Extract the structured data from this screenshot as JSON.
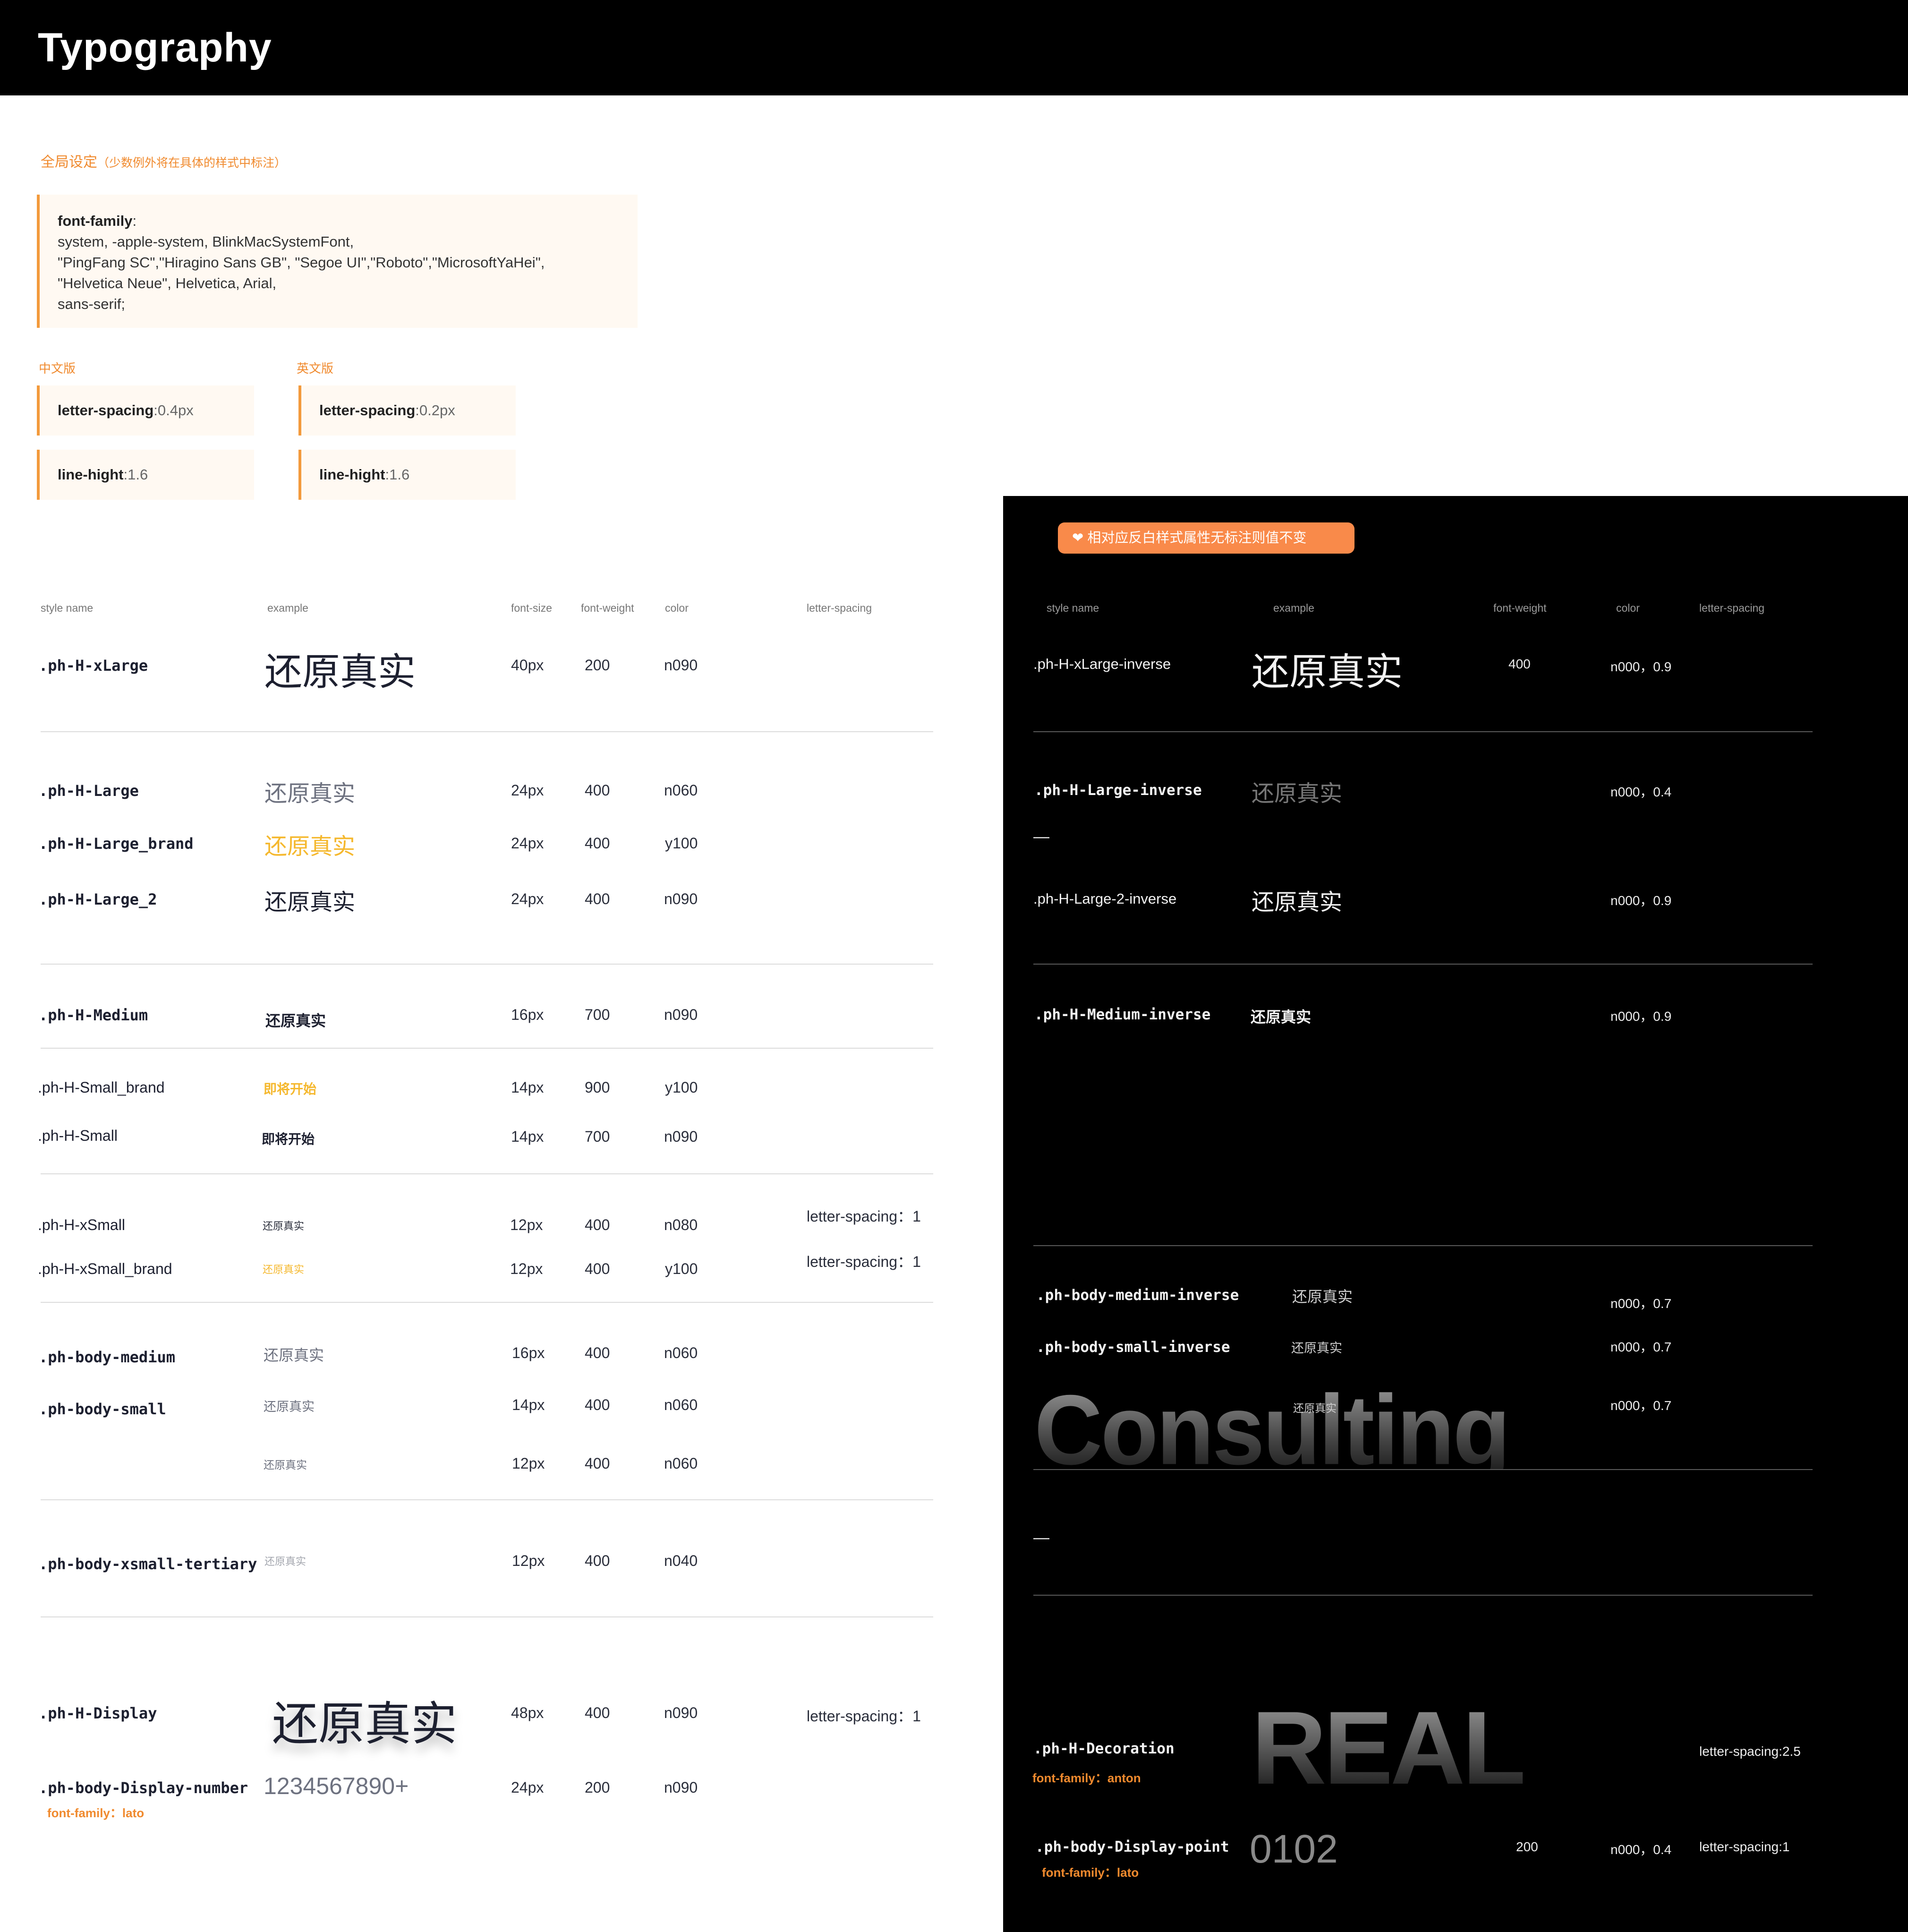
{
  "header": {
    "title": "Typography"
  },
  "global": {
    "heading": "全局设定",
    "heading_note": "（少数例外将在具体的样式中标注）",
    "font_family_label": "font-family",
    "font_family_colon": ":",
    "font_family_lines": [
      "system, -apple-system, BlinkMacSystemFont,",
      "\"PingFang SC\",\"Hiragino Sans GB\", \"Segoe UI\",\"Roboto\",\"MicrosoftYaHei\",",
      "\"Helvetica Neue\", Helvetica, Arial,",
      "sans-serif;"
    ],
    "cn_label": "中文版",
    "en_label": "英文版",
    "cn_letter_spacing_label": "letter-spacing",
    "cn_letter_spacing_value": ":0.4px",
    "cn_line_height_label": "line-hight",
    "cn_line_height_value": ":1.6",
    "en_letter_spacing_label": "letter-spacing",
    "en_letter_spacing_value": ":0.2px",
    "en_line_height_label": "line-hight",
    "en_line_height_value": ":1.6"
  },
  "light_table": {
    "headers": {
      "style_name": "style name",
      "example": "example",
      "font_size": "font-size",
      "font_weight": "font-weight",
      "color": "color",
      "letter_spacing": "letter-spacing"
    },
    "rows": [
      {
        "name": ".ph-H-xLarge",
        "example": "还原真实",
        "size": "40px",
        "weight": "200",
        "color": "n090",
        "ls": ""
      },
      {
        "name": ".ph-H-Large",
        "example": "还原真实",
        "size": "24px",
        "weight": "400",
        "color": "n060",
        "ls": ""
      },
      {
        "name": ".ph-H-Large_brand",
        "example": "还原真实",
        "size": "24px",
        "weight": "400",
        "color": "y100",
        "ls": ""
      },
      {
        "name": ".ph-H-Large_2",
        "example": "还原真实",
        "size": "24px",
        "weight": "400",
        "color": "n090",
        "ls": ""
      },
      {
        "name": ".ph-H-Medium",
        "example": "还原真实",
        "size": "16px",
        "weight": "700",
        "color": "n090",
        "ls": ""
      },
      {
        "name": ".ph-H-Small_brand",
        "example": "即将开始",
        "size": "14px",
        "weight": "900",
        "color": "y100",
        "ls": ""
      },
      {
        "name": ".ph-H-Small",
        "example": "即将开始",
        "size": "14px",
        "weight": "700",
        "color": "n090",
        "ls": ""
      },
      {
        "name": ".ph-H-xSmall",
        "example": "还原真实",
        "size": "12px",
        "weight": "400",
        "color": "n080",
        "ls": "letter-spacing：1"
      },
      {
        "name": ".ph-H-xSmall_brand",
        "example": "还原真实",
        "size": "12px",
        "weight": "400",
        "color": "y100",
        "ls": "letter-spacing：1"
      },
      {
        "name": ".ph-body-medium",
        "example": "还原真实",
        "size": "16px",
        "weight": "400",
        "color": "n060",
        "ls": ""
      },
      {
        "name": ".ph-body-small",
        "example": "还原真实",
        "size": "14px",
        "weight": "400",
        "color": "n060",
        "ls": ""
      },
      {
        "name": "",
        "example": "还原真实",
        "size": "12px",
        "weight": "400",
        "color": "n060",
        "ls": ""
      },
      {
        "name": ".ph-body-xsmall-tertiary",
        "example": "还原真实",
        "size": "12px",
        "weight": "400",
        "color": "n040",
        "ls": ""
      },
      {
        "name": ".ph-H-Display",
        "example": "还原真实",
        "size": "48px",
        "weight": "400",
        "color": "n090",
        "ls": "letter-spacing：1"
      },
      {
        "name": ".ph-body-Display-number",
        "example": "1234567890+",
        "size": "24px",
        "weight": "200",
        "color": "n090",
        "ls": ""
      }
    ],
    "display_number_font_note": "font-family：lato"
  },
  "dark_table": {
    "notice": "❤ 相对应反白样式属性无标注则值不变",
    "headers": {
      "style_name": "style name",
      "example": "example",
      "font_weight": "font-weight",
      "color": "color",
      "letter_spacing": "letter-spacing"
    },
    "rows": [
      {
        "name": ".ph-H-xLarge-inverse",
        "example": "还原真实",
        "weight": "400",
        "color": "n000，0.9",
        "ls": ""
      },
      {
        "name": ".ph-H-Large-inverse",
        "example": "还原真实",
        "weight": "",
        "color": "n000，0.4",
        "ls": ""
      },
      {
        "name": ".ph-H-Large-2-inverse",
        "example": "还原真实",
        "weight": "",
        "color": "n000，0.9",
        "ls": ""
      },
      {
        "name": ".ph-H-Medium-inverse",
        "example": "还原真实",
        "weight": "",
        "color": "n000，0.9",
        "ls": ""
      },
      {
        "name": ".ph-body-medium-inverse",
        "example": "还原真实",
        "weight": "",
        "color": "n000，0.7",
        "ls": ""
      },
      {
        "name": ".ph-body-small-inverse",
        "example": "还原真实",
        "weight": "",
        "color": "n000，0.7",
        "ls": ""
      },
      {
        "name": "",
        "example": "还原真实",
        "weight": "",
        "color": "n000，0.7",
        "ls": ""
      },
      {
        "name": ".ph-H-Decoration",
        "example": "REAL",
        "weight": "",
        "color": "",
        "ls": "letter-spacing:2.5"
      },
      {
        "name": ".ph-body-Display-point",
        "example": "0102",
        "weight": "200",
        "color": "n000，0.4",
        "ls": "letter-spacing:1"
      }
    ],
    "decoration_font_note": "font-family：anton",
    "point_font_note": "font-family：lato",
    "dash_1": "—",
    "dash_2": "—",
    "consulting": "Consulting"
  },
  "colors": {
    "brand_orange": "#f08a2e",
    "brand_yellow": "#f5b82e",
    "dark_bg": "#000000",
    "card_bg": "#fff9f2",
    "pill_bg": "#f98a4a"
  }
}
